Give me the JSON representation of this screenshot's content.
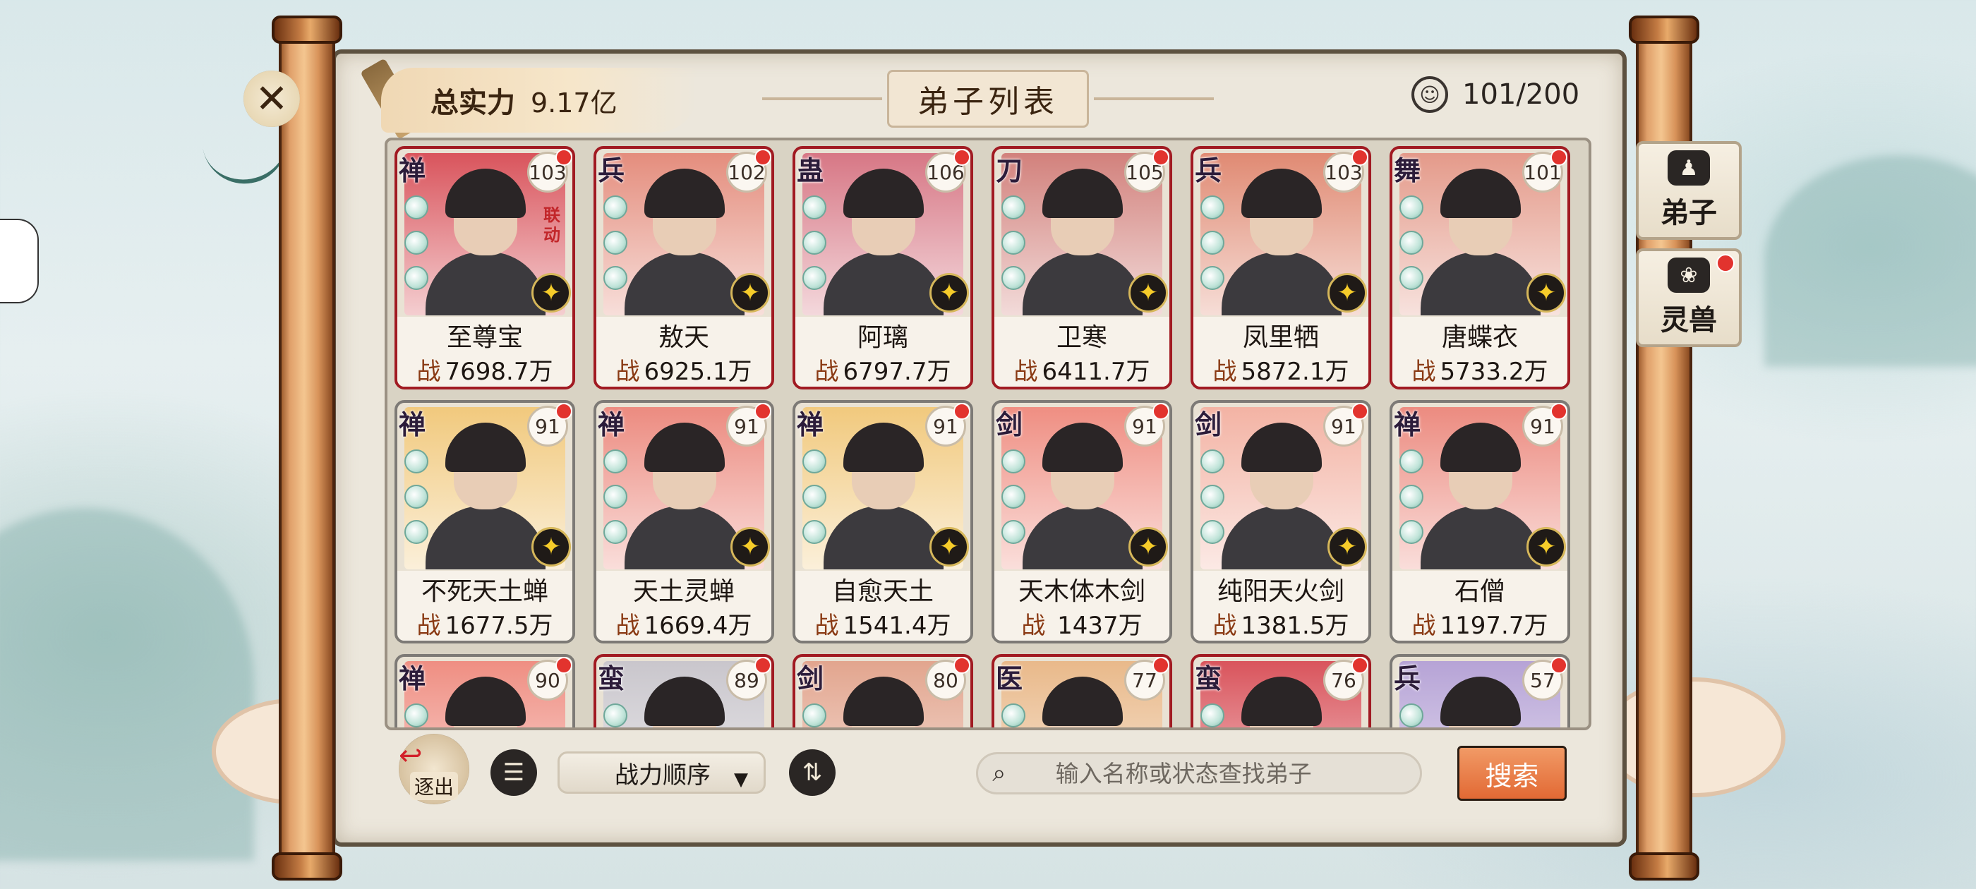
{
  "header": {
    "power_label": "总实力",
    "power_value": "9.17亿",
    "title": "弟子列表",
    "count": "101/200"
  },
  "side_tabs": [
    {
      "label": "弟子",
      "icon": "disciple-icon",
      "has_dot": false
    },
    {
      "label": "灵兽",
      "icon": "spirit-beast-icon",
      "has_dot": true
    }
  ],
  "stat_prefix": "战",
  "cards": [
    {
      "faction": "禅",
      "level": "103",
      "name": "至尊宝",
      "power": "7698.7万",
      "tier": "red",
      "badge": "联动",
      "bg": "#d9545c"
    },
    {
      "faction": "兵",
      "level": "102",
      "name": "敖天",
      "power": "6925.1万",
      "tier": "red",
      "badge": "",
      "bg": "#e48d7d"
    },
    {
      "faction": "蛊",
      "level": "106",
      "name": "阿璃",
      "power": "6797.7万",
      "tier": "red",
      "badge": "",
      "bg": "#d77785"
    },
    {
      "faction": "刀",
      "level": "105",
      "name": "卫寒",
      "power": "6411.7万",
      "tier": "red",
      "badge": "",
      "bg": "#d2817c"
    },
    {
      "faction": "兵",
      "level": "103",
      "name": "凤里牺",
      "power": "5872.1万",
      "tier": "red",
      "badge": "",
      "bg": "#e08a73"
    },
    {
      "faction": "舞",
      "level": "101",
      "name": "唐蝶衣",
      "power": "5733.2万",
      "tier": "red",
      "badge": "",
      "bg": "#e49a8a"
    },
    {
      "faction": "禅",
      "level": "91",
      "name": "不死天土蝉",
      "power": "1677.5万",
      "tier": "gray",
      "badge": "",
      "bg": "#f1c97d"
    },
    {
      "faction": "禅",
      "level": "91",
      "name": "天土灵蝉",
      "power": "1669.4万",
      "tier": "gray",
      "badge": "",
      "bg": "#ec8b80"
    },
    {
      "faction": "禅",
      "level": "91",
      "name": "自愈天土",
      "power": "1541.4万",
      "tier": "gray",
      "badge": "",
      "bg": "#f1c97d"
    },
    {
      "faction": "剑",
      "level": "91",
      "name": "天木体木剑",
      "power": " 1437万",
      "tier": "gray",
      "badge": "",
      "bg": "#ef8e82"
    },
    {
      "faction": "剑",
      "level": "91",
      "name": "纯阳天火剑",
      "power": "1381.5万",
      "tier": "gray",
      "badge": "",
      "bg": "#f3b3a4"
    },
    {
      "faction": "禅",
      "level": "91",
      "name": "石僧",
      "power": "1197.7万",
      "tier": "gray",
      "badge": "",
      "bg": "#ec8b80"
    },
    {
      "faction": "禅",
      "level": "90",
      "name": "",
      "power": "",
      "tier": "gray",
      "badge": "",
      "bg": "#ef8e82"
    },
    {
      "faction": "蛮",
      "level": "89",
      "name": "",
      "power": "",
      "tier": "red",
      "badge": "",
      "bg": "#c9c6cc"
    },
    {
      "faction": "剑",
      "level": "80",
      "name": "",
      "power": "",
      "tier": "red",
      "badge": "",
      "bg": "#e2a58e"
    },
    {
      "faction": "医",
      "level": "77",
      "name": "",
      "power": "",
      "tier": "red",
      "badge": "",
      "bg": "#e9b98a"
    },
    {
      "faction": "蛮",
      "level": "76",
      "name": "",
      "power": "",
      "tier": "red",
      "badge": "",
      "bg": "#d9545c"
    },
    {
      "faction": "兵",
      "level": "57",
      "name": "",
      "power": "",
      "tier": "gray",
      "badge": "",
      "bg": "#b6a3d6"
    }
  ],
  "toolbar": {
    "exit_label": "逐出",
    "sort_value": "战力顺序",
    "search_placeholder": "输入名称或状态查找弟子",
    "search_button": "搜索"
  },
  "colors": {
    "accent_red": "#a11a22",
    "search_button": "#e26934",
    "star_gold": "#f6cc2a"
  }
}
